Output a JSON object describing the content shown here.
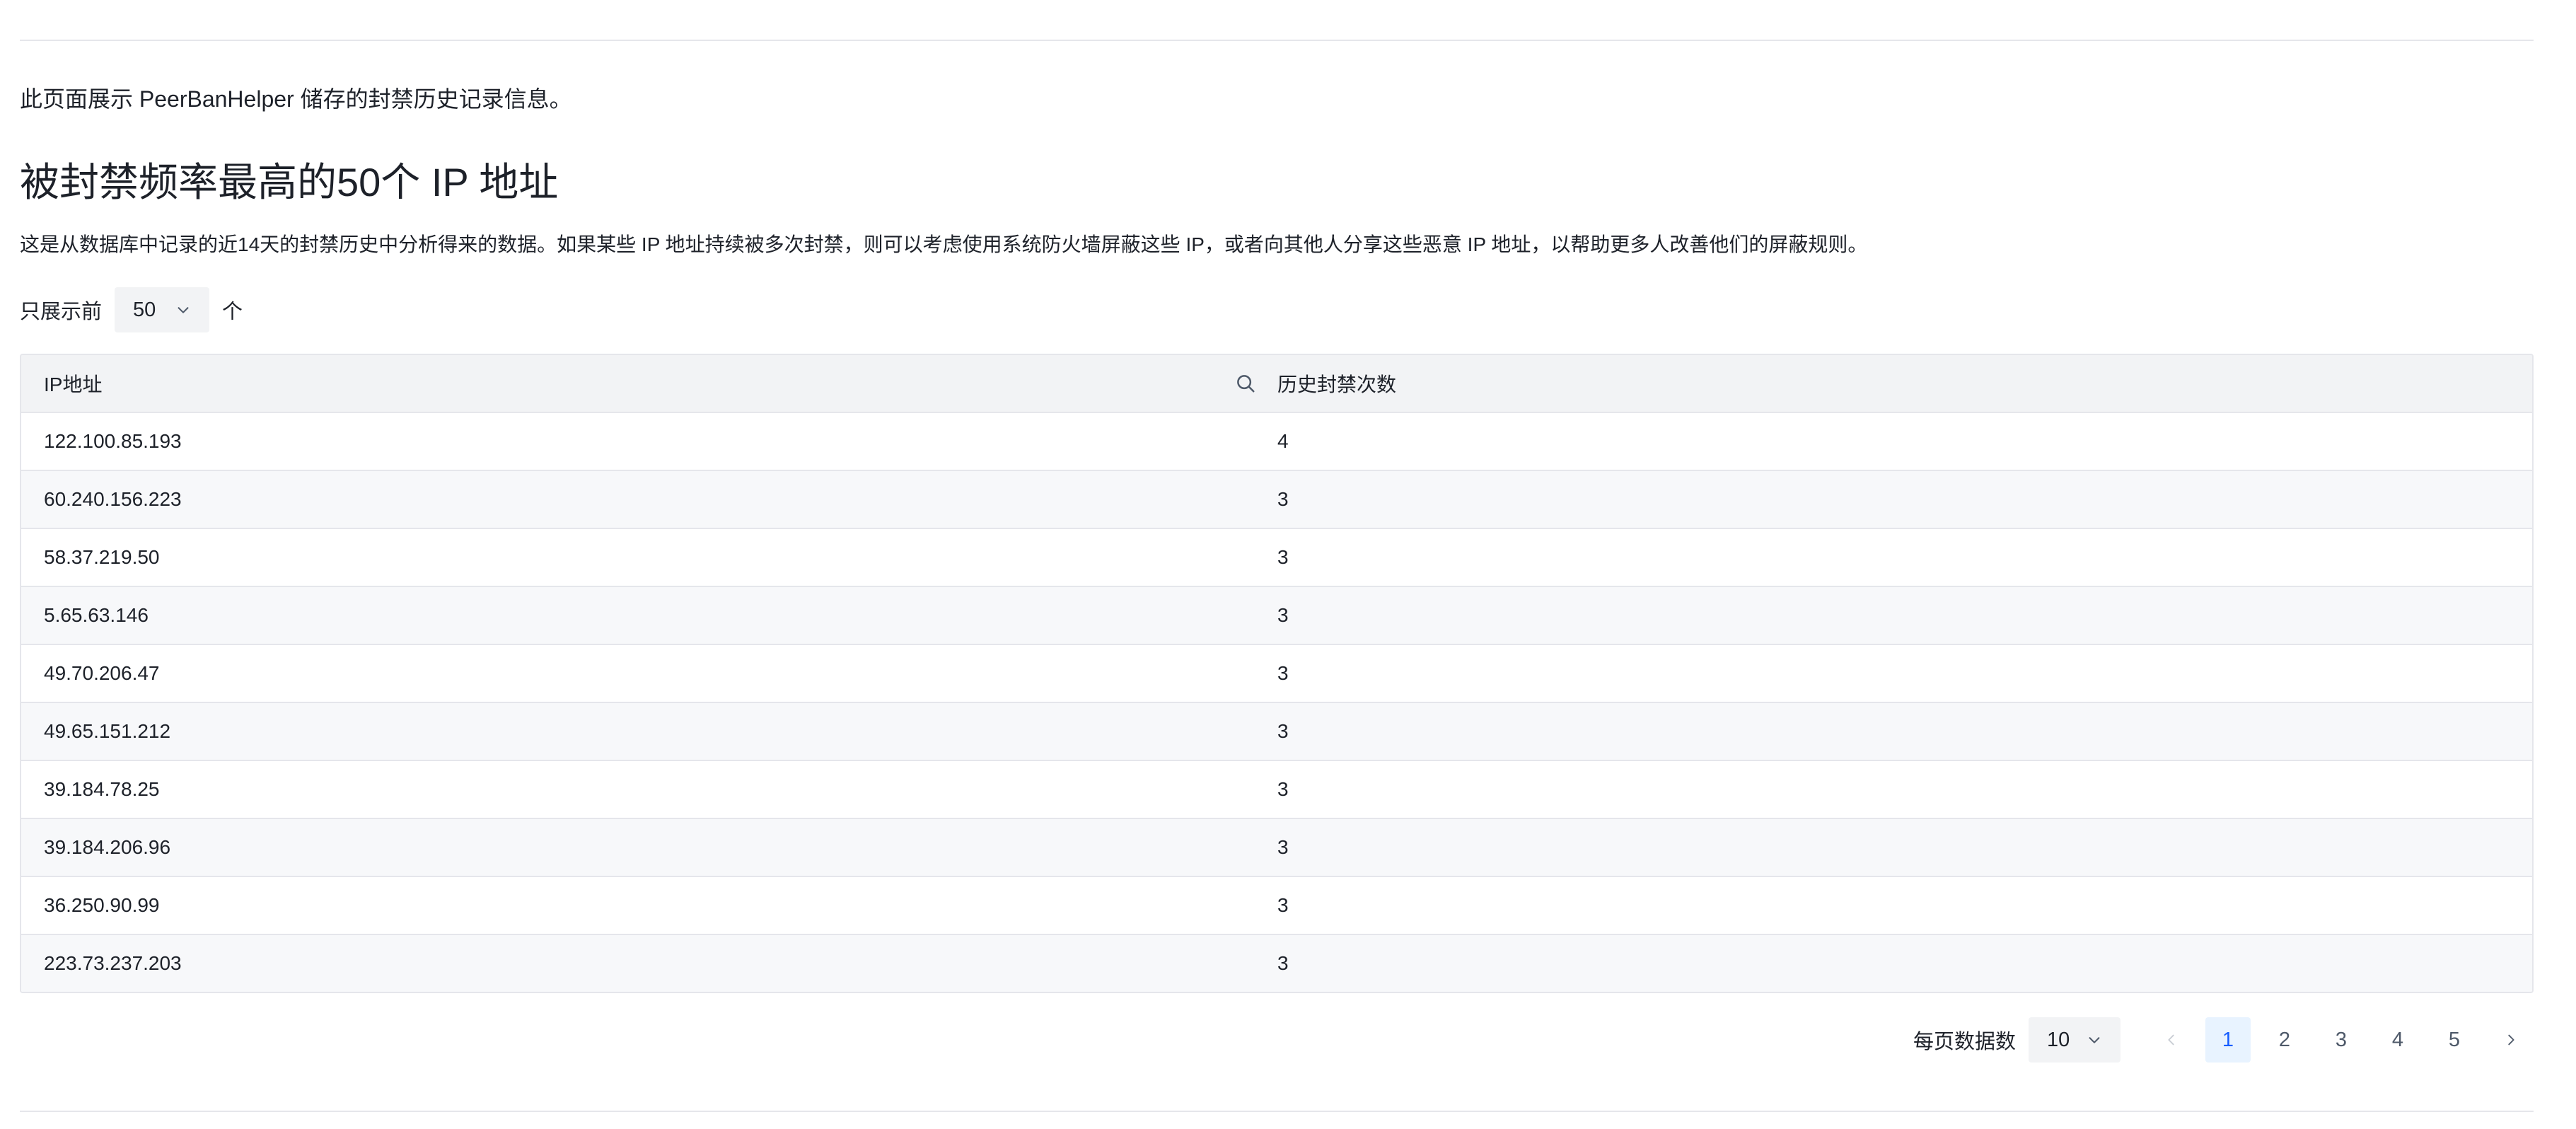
{
  "intro_text": "此页面展示 PeerBanHelper 储存的封禁历史记录信息。",
  "heading": "被封禁频率最高的50个 IP 地址",
  "description": "这是从数据库中记录的近14天的封禁历史中分析得来的数据。如果某些 IP 地址持续被多次封禁，则可以考虑使用系统防火墙屏蔽这些 IP，或者向其他人分享这些恶意 IP 地址，以帮助更多人改善他们的屏蔽规则。",
  "limit": {
    "prefix": "只展示前",
    "value": "50",
    "suffix": "个"
  },
  "table": {
    "columns": [
      "IP地址",
      "历史封禁次数"
    ],
    "rows": [
      {
        "ip": "122.100.85.193",
        "count": "4"
      },
      {
        "ip": "60.240.156.223",
        "count": "3"
      },
      {
        "ip": "58.37.219.50",
        "count": "3"
      },
      {
        "ip": "5.65.63.146",
        "count": "3"
      },
      {
        "ip": "49.70.206.47",
        "count": "3"
      },
      {
        "ip": "49.65.151.212",
        "count": "3"
      },
      {
        "ip": "39.184.78.25",
        "count": "3"
      },
      {
        "ip": "39.184.206.96",
        "count": "3"
      },
      {
        "ip": "36.250.90.99",
        "count": "3"
      },
      {
        "ip": "223.73.237.203",
        "count": "3"
      }
    ]
  },
  "pagination": {
    "page_size_label": "每页数据数",
    "page_size": "10",
    "pages": [
      "1",
      "2",
      "3",
      "4",
      "5"
    ],
    "current_page": "1"
  },
  "icons": {
    "search": "search-icon",
    "chevron_down": "chevron-down-icon",
    "prev": "chevron-left-icon",
    "next": "chevron-right-icon"
  },
  "colors": {
    "accent": "#165dff",
    "accent_bg": "#e8f3ff",
    "header_bg": "#f2f3f5",
    "stripe_bg": "#f7f8fa",
    "border": "#e5e6eb"
  }
}
